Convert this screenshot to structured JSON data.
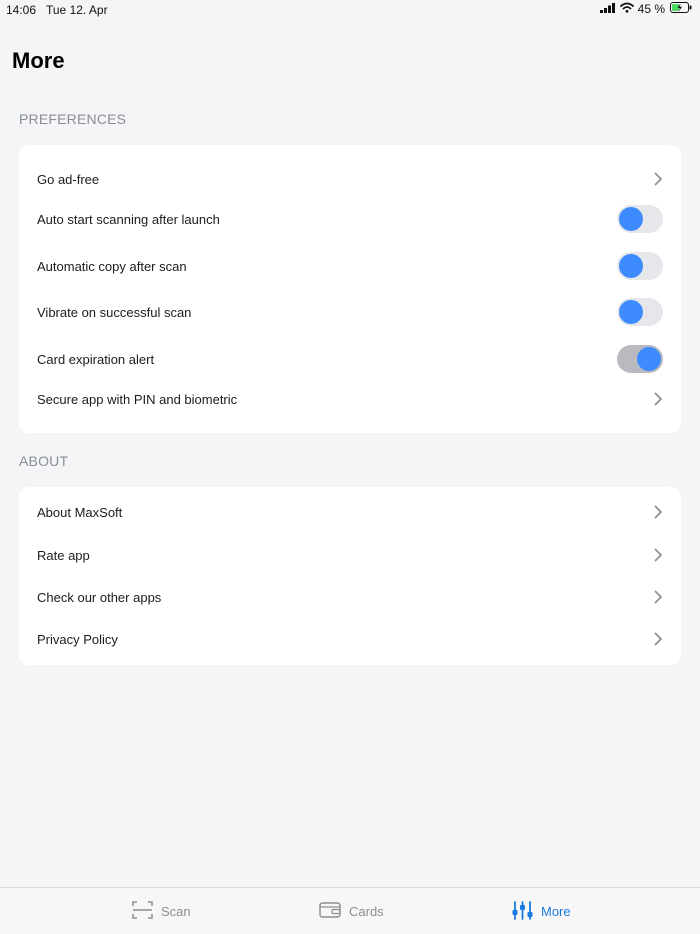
{
  "status_bar": {
    "time": "14:06",
    "date": "Tue 12. Apr",
    "battery_percent": "45 %",
    "battery_level": 0.45,
    "icons": [
      "signal-icon",
      "wifi-icon",
      "battery-charging-icon"
    ]
  },
  "page": {
    "title": "More"
  },
  "preferences": {
    "header": "PREFERENCES",
    "items": [
      {
        "label": "Go ad-free",
        "control": "chevron"
      },
      {
        "label": "Auto start scanning after launch",
        "control": "toggle",
        "on": false
      },
      {
        "label": "Automatic copy after scan",
        "control": "toggle",
        "on": false
      },
      {
        "label": "Vibrate on successful scan",
        "control": "toggle",
        "on": false
      },
      {
        "label": "Card expiration alert",
        "control": "toggle",
        "on": true
      },
      {
        "label": "Secure app with PIN and biometric",
        "control": "chevron"
      }
    ]
  },
  "about": {
    "header": "ABOUT",
    "items": [
      {
        "label": "About MaxSoft",
        "control": "chevron"
      },
      {
        "label": "Rate app",
        "control": "chevron"
      },
      {
        "label": "Check our other apps",
        "control": "chevron"
      },
      {
        "label": "Privacy Policy",
        "control": "chevron"
      }
    ]
  },
  "tab_bar": {
    "tabs": [
      {
        "label": "Scan",
        "icon": "scan-icon",
        "active": false
      },
      {
        "label": "Cards",
        "icon": "wallet-icon",
        "active": false
      },
      {
        "label": "More",
        "icon": "sliders-icon",
        "active": true
      }
    ]
  },
  "colors": {
    "accent": "#1a7ae0",
    "toggle_knob": "#3d8bff",
    "background": "#f4f5f7",
    "card": "#ffffff",
    "secondary_text": "#8a8d93"
  }
}
